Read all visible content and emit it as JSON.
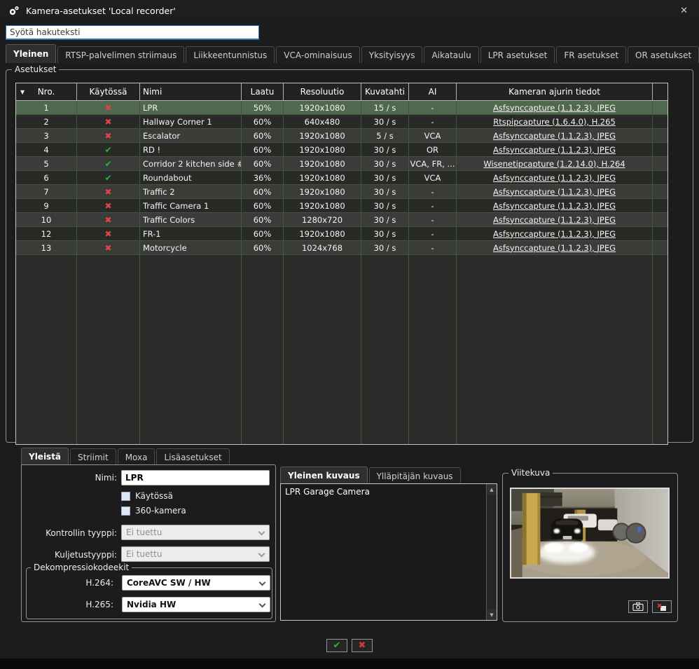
{
  "window": {
    "title": "Kamera-asetukset 'Local recorder'",
    "close_glyph": "✕"
  },
  "search": {
    "placeholder": "Syötä hakuteksti"
  },
  "main_tabs": [
    "Yleinen",
    "RTSP-palvelimen striimaus",
    "Liikkeentunnistus",
    "VCA-ominaisuus",
    "Yksityisyys",
    "Aikataulu",
    "LPR asetukset",
    "FR asetukset",
    "OR asetukset"
  ],
  "settings_group": {
    "label": "Asetukset",
    "sort_glyph": "▼",
    "columns": [
      "Nro.",
      "Käytössä",
      "Nimi",
      "Laatu",
      "Resoluutio",
      "Kuvatahti",
      "AI",
      "Kameran ajurin tiedot"
    ],
    "enabled_glyph": "✔",
    "disabled_glyph": "✖",
    "rows": [
      {
        "nro": "1",
        "enabled": false,
        "name": "LPR",
        "quality": "50%",
        "resolution": "1920x1080",
        "framerate": "15 / s",
        "ai": "-",
        "driver": "Asfsynccapture (1.1.2.3), JPEG",
        "selected": true
      },
      {
        "nro": "2",
        "enabled": false,
        "name": "Hallway Corner 1",
        "quality": "60%",
        "resolution": "640x480",
        "framerate": "30 / s",
        "ai": "-",
        "driver": "Rtspipcapture (1.6.4.0), H.265",
        "selected": false
      },
      {
        "nro": "3",
        "enabled": false,
        "name": "Escalator",
        "quality": "60%",
        "resolution": "1920x1080",
        "framerate": "5 / s",
        "ai": "VCA",
        "driver": "Asfsynccapture (1.1.2.3), JPEG",
        "selected": false
      },
      {
        "nro": "4",
        "enabled": true,
        "name": "RD !",
        "quality": "60%",
        "resolution": "1920x1080",
        "framerate": "30 / s",
        "ai": "OR",
        "driver": "Asfsynccapture (1.1.2.3), JPEG",
        "selected": false
      },
      {
        "nro": "5",
        "enabled": true,
        "name": "Corridor 2 kitchen side #",
        "quality": "60%",
        "resolution": "1920x1080",
        "framerate": "30 / s",
        "ai": "VCA, FR, ...",
        "driver": "Wisenetipcapture (1.2.14.0), H.264",
        "selected": false
      },
      {
        "nro": "6",
        "enabled": true,
        "name": "Roundabout",
        "quality": "36%",
        "resolution": "1920x1080",
        "framerate": "30 / s",
        "ai": "VCA",
        "driver": "Asfsynccapture (1.1.2.3), JPEG",
        "selected": false
      },
      {
        "nro": "7",
        "enabled": false,
        "name": "Traffic 2",
        "quality": "60%",
        "resolution": "1920x1080",
        "framerate": "30 / s",
        "ai": "-",
        "driver": "Asfsynccapture (1.1.2.3), JPEG",
        "selected": false
      },
      {
        "nro": "9",
        "enabled": false,
        "name": "Traffic Camera 1",
        "quality": "60%",
        "resolution": "1920x1080",
        "framerate": "30 / s",
        "ai": "-",
        "driver": "Asfsynccapture (1.1.2.3), JPEG",
        "selected": false
      },
      {
        "nro": "10",
        "enabled": false,
        "name": "Traffic Colors",
        "quality": "60%",
        "resolution": "1280x720",
        "framerate": "30 / s",
        "ai": "-",
        "driver": "Asfsynccapture (1.1.2.3), JPEG",
        "selected": false
      },
      {
        "nro": "12",
        "enabled": false,
        "name": "FR-1",
        "quality": "60%",
        "resolution": "1920x1080",
        "framerate": "30 / s",
        "ai": "-",
        "driver": "Asfsynccapture (1.1.2.3), JPEG",
        "selected": false
      },
      {
        "nro": "13",
        "enabled": false,
        "name": "Motorcycle",
        "quality": "60%",
        "resolution": "1024x768",
        "framerate": "30 / s",
        "ai": "-",
        "driver": "Asfsynccapture (1.1.2.3), JPEG",
        "selected": false
      }
    ]
  },
  "detail_tabs": [
    "Yleistä",
    "Striimit",
    "Moxa",
    "Lisäasetukset"
  ],
  "general_form": {
    "name_label": "Nimi:",
    "name_value": "LPR",
    "enabled_checkbox_label": "Käytössä",
    "enabled_checked": false,
    "camera360_checkbox_label": "360-kamera",
    "camera360_checked": false,
    "control_type_label": "Kontrollin tyyppi:",
    "control_type_value": "Ei tuettu",
    "transport_type_label": "Kuljetustyyppi:",
    "transport_type_value": "Ei tuettu",
    "codecs_group_label": "Dekompressiokodeekit",
    "h264_label": "H.264:",
    "h264_value": "CoreAVC SW / HW",
    "h265_label": "H.265:",
    "h265_value": "Nvidia HW"
  },
  "description": {
    "tabs": [
      "Yleinen kuvaus",
      "Ylläpitäjän kuvaus"
    ],
    "text": "LPR Garage Camera",
    "scroll_up_glyph": "▲",
    "scroll_down_glyph": "▼"
  },
  "reference_image": {
    "label": "Viitekuva"
  },
  "footer": {
    "ok_glyph": "✔",
    "cancel_glyph": "✖"
  },
  "colors": {
    "selected_row": "#50694e",
    "enabled_check": "#35b335",
    "disabled_cross": "#e04343",
    "search_border": "#2f6fb3"
  }
}
